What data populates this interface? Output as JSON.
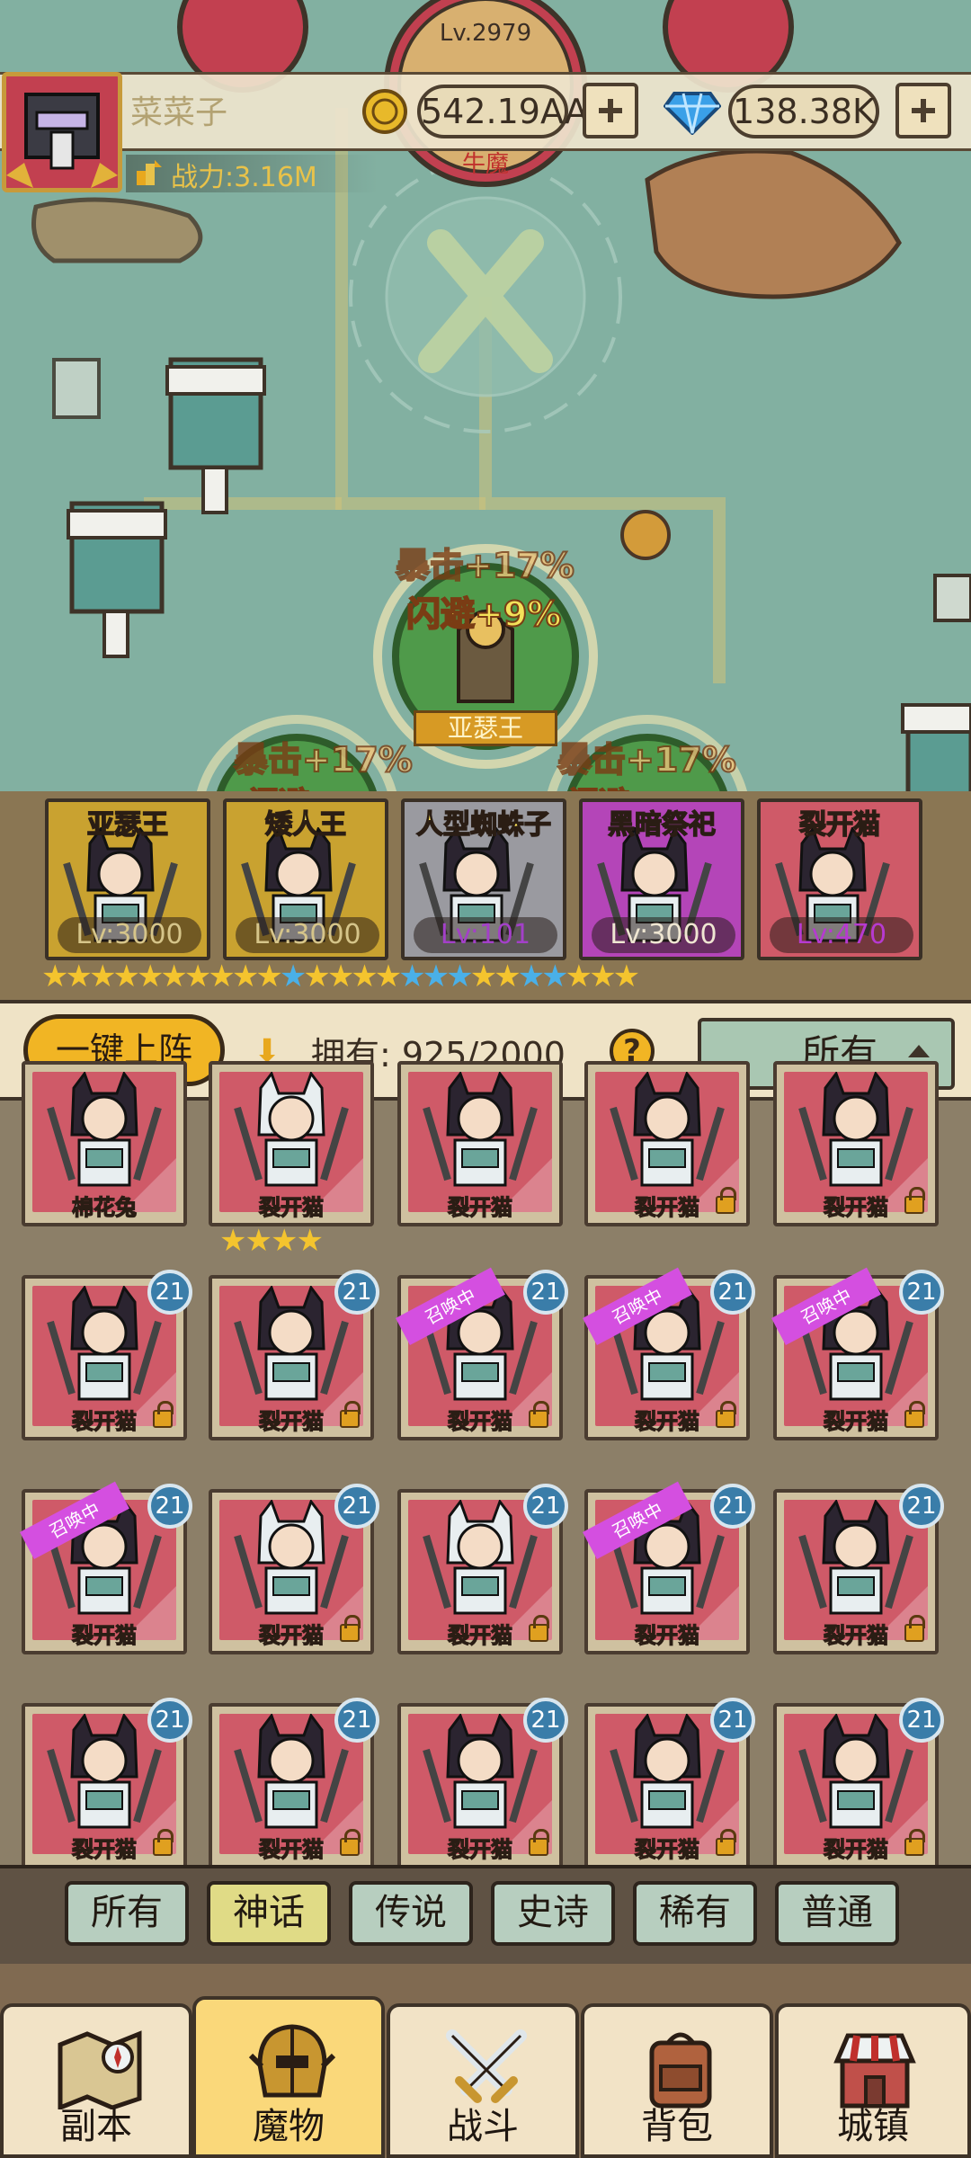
{
  "player": {
    "name": "菜菜子",
    "power_label": "战力:3.16M",
    "gold": "542.19AA",
    "gems": "138.38K"
  },
  "map": {
    "boss_level": "Lv.2979",
    "boss_tag": "牛魔",
    "buffs": {
      "top_crit": "暴击+17%",
      "top_dodge": "闪避+9%",
      "left_crit": "暴击+17%",
      "left_dodge": "闪避",
      "right_crit": "暴击+17%",
      "right_dodge": "闪避"
    },
    "leader_name": "亚瑟王"
  },
  "lineup": [
    {
      "name": "亚瑟王",
      "level": "Lv:3000",
      "bg": "#c9a230",
      "lvcolor": "#d6c58a"
    },
    {
      "name": "矮人王",
      "level": "Lv:3000",
      "bg": "#c9a230",
      "lvcolor": "#d6c58a"
    },
    {
      "name": "人型蜘蛛子",
      "level": "Lv:101",
      "bg": "#9a9aa0",
      "lvcolor": "#a340c8"
    },
    {
      "name": "黑暗祭祀",
      "level": "Lv:3000",
      "bg": "#b445b8",
      "lvcolor": "#efe6d2"
    },
    {
      "name": "裂开猫",
      "level": "Lv:470",
      "bg": "#cf5a68",
      "lvcolor": "#b63ad0"
    }
  ],
  "lineup_stars": [
    {
      "count": 5,
      "color": "gold"
    },
    {
      "count": 5,
      "color": "gold"
    },
    {
      "count": 5,
      "color": "mixed"
    },
    {
      "count": 5,
      "color": "mixed"
    },
    {
      "count": 5,
      "color": "mixed"
    }
  ],
  "controls": {
    "auto_deploy": "一键上阵",
    "owned_label": "拥有:",
    "owned_value": "925/2000",
    "help": "?",
    "filter_value": "所有"
  },
  "cards": [
    {
      "name": "棉花兔",
      "gold": false,
      "badge": "",
      "lock": false,
      "ribbon": ""
    },
    {
      "name": "裂开猫",
      "gold": true,
      "badge": "",
      "lock": false,
      "ribbon": ""
    },
    {
      "name": "裂开猫",
      "gold": false,
      "badge": "",
      "lock": false,
      "ribbon": ""
    },
    {
      "name": "裂开猫",
      "gold": false,
      "badge": "",
      "lock": true,
      "ribbon": ""
    },
    {
      "name": "裂开猫",
      "gold": false,
      "badge": "",
      "lock": true,
      "ribbon": ""
    },
    {
      "name": "裂开猫",
      "gold": false,
      "badge": "21",
      "lock": true,
      "ribbon": ""
    },
    {
      "name": "裂开猫",
      "gold": false,
      "badge": "21",
      "lock": true,
      "ribbon": ""
    },
    {
      "name": "裂开猫",
      "gold": false,
      "badge": "21",
      "lock": true,
      "ribbon": "召唤中"
    },
    {
      "name": "裂开猫",
      "gold": false,
      "badge": "21",
      "lock": true,
      "ribbon": "召唤中"
    },
    {
      "name": "裂开猫",
      "gold": false,
      "badge": "21",
      "lock": true,
      "ribbon": "召唤中"
    },
    {
      "name": "裂开猫",
      "gold": false,
      "badge": "21",
      "lock": false,
      "ribbon": "召唤中"
    },
    {
      "name": "裂开猫",
      "gold": true,
      "badge": "21",
      "lock": true,
      "ribbon": ""
    },
    {
      "name": "裂开猫",
      "gold": true,
      "badge": "21",
      "lock": true,
      "ribbon": ""
    },
    {
      "name": "裂开猫",
      "gold": false,
      "badge": "21",
      "lock": false,
      "ribbon": "召唤中"
    },
    {
      "name": "裂开猫",
      "gold": false,
      "badge": "21",
      "lock": true,
      "ribbon": ""
    },
    {
      "name": "裂开猫",
      "gold": false,
      "badge": "21",
      "lock": true,
      "ribbon": ""
    },
    {
      "name": "裂开猫",
      "gold": false,
      "badge": "21",
      "lock": true,
      "ribbon": ""
    },
    {
      "name": "裂开猫",
      "gold": false,
      "badge": "21",
      "lock": true,
      "ribbon": ""
    },
    {
      "name": "裂开猫",
      "gold": false,
      "badge": "21",
      "lock": true,
      "ribbon": ""
    },
    {
      "name": "裂开猫",
      "gold": false,
      "badge": "21",
      "lock": true,
      "ribbon": ""
    }
  ],
  "rarity_tabs": [
    "所有",
    "神话",
    "传说",
    "史诗",
    "稀有",
    "普通"
  ],
  "active_rarity": 1,
  "nav": [
    {
      "label": "副本",
      "icon": "map-icon"
    },
    {
      "label": "魔物",
      "icon": "helmet-icon"
    },
    {
      "label": "战斗",
      "icon": "swords-icon"
    },
    {
      "label": "背包",
      "icon": "backpack-icon"
    },
    {
      "label": "城镇",
      "icon": "shop-icon"
    }
  ],
  "active_nav": 1,
  "colors": {
    "accent_gold": "#f1b524",
    "card_red": "#cf5a68",
    "badge_blue": "#3a7da9",
    "ribbon_pink": "#d44fe0"
  }
}
